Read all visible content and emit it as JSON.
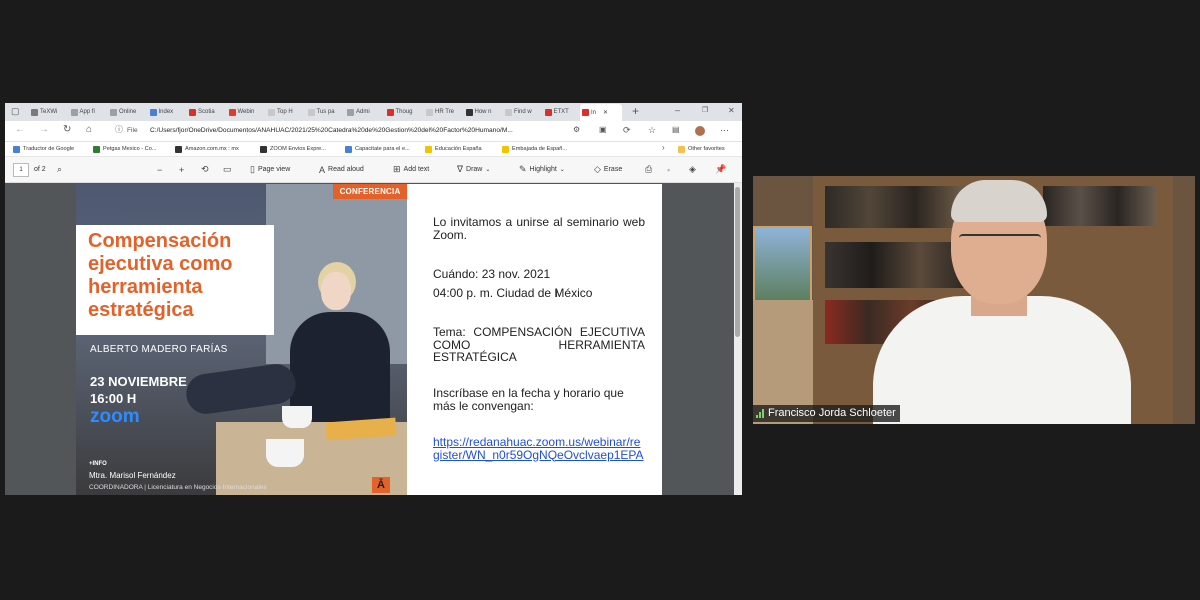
{
  "browser": {
    "tabs": [
      {
        "label": "TeXWi",
        "color": "#7a7a7a"
      },
      {
        "label": "App fi",
        "color": "#9aa0a6"
      },
      {
        "label": "Online",
        "color": "#9aa0a6"
      },
      {
        "label": "Index",
        "color": "#4a7fd3"
      },
      {
        "label": "Scotia",
        "color": "#d9302a"
      },
      {
        "label": "Webin",
        "color": "#e23b2e"
      },
      {
        "label": "Top H",
        "color": "#c8c8c8"
      },
      {
        "label": "Tus pa",
        "color": "#c8c8c8"
      },
      {
        "label": "Admi",
        "color": "#9aa0a6"
      },
      {
        "label": "Thoug",
        "color": "#d9302a"
      },
      {
        "label": "HR Tre",
        "color": "#c8c8c8"
      },
      {
        "label": "How n",
        "color": "#333333"
      },
      {
        "label": "Find w",
        "color": "#c8c8c8"
      },
      {
        "label": "ETXT",
        "color": "#d9302a"
      },
      {
        "label": "In",
        "color": "#d9302a"
      }
    ],
    "new_tab": "+",
    "window_controls": {
      "minimize": "–",
      "restore": "❐",
      "close": "✕"
    },
    "url_prefix": "File",
    "url": "C:/Users/fjor/OneDrive/Documentos/ANAHUAC/2021/25%20Catedra%20de%20Gestion%20del%20Factor%20Humano/M...",
    "bookmarks": [
      {
        "label": "Traductor de Google",
        "color": "#4a7fd3"
      },
      {
        "label": "Petgas Mexico - Co...",
        "color": "#2e7d32"
      },
      {
        "label": "Amazon.com.mx : mx",
        "color": "#333333"
      },
      {
        "label": "ZOOM Envios Expre...",
        "color": "#333333"
      },
      {
        "label": "Capacitate para el e...",
        "color": "#4a7fd3"
      },
      {
        "label": "Educación España",
        "color": "#f0c400"
      },
      {
        "label": "Embajada de Españ...",
        "color": "#f0c400"
      }
    ],
    "other_favorites": "Other favorites"
  },
  "pdf_toolbar": {
    "page_number": "1",
    "page_count": "of 2",
    "page_view": "Page view",
    "read_aloud": "Read aloud",
    "add_text": "Add text",
    "draw": "Draw",
    "highlight": "Highlight",
    "erase": "Erase"
  },
  "flyer": {
    "banner": "CONFERENCIA",
    "title": "Compensación ejecutiva como herramienta estratégica",
    "author": "ALBERTO MADERO FARÍAS",
    "date": "23 NOVIEMBRE",
    "time": "16:00 H",
    "platform": "zoom",
    "info_label": "+INFO",
    "contact": "Mtra. Marisol Fernández",
    "role": "COORDINADORA | Licenciatura en Negocios Internacionales"
  },
  "invitation": {
    "intro": "Lo invitamos a unirse al seminario web Zoom.",
    "when": "Cuándo: 23 nov. 2021",
    "time": "04:00 p. m. Ciudad de México",
    "topic_line1": "Tema: COMPENSACIÓN EJECUTIVA",
    "topic_line2": "COMO HERRAMIENTA",
    "topic_line3": "ESTRATÉGICA",
    "register": "Inscríbase en la fecha y horario que más le convengan:",
    "link": "https://redanahuac.zoom.us/webinar/register/WN_n0r59OgNQeOvclvaep1EPA"
  },
  "participant": {
    "name": "Francisco Jorda Schloeter"
  },
  "colors": {
    "accent_orange": "#e4622a",
    "zoom_blue": "#2d8cff",
    "link_blue": "#1f4fd8"
  }
}
